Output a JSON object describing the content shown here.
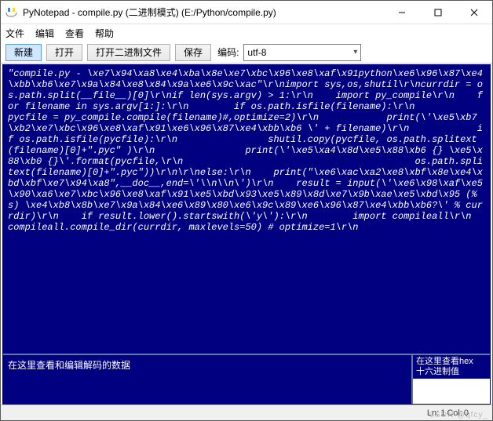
{
  "window": {
    "title": "PyNotepad - compile.py (二进制模式) (E:/Python/compile.py)"
  },
  "menu": {
    "file": "文件",
    "edit": "编辑",
    "view": "查看",
    "help": "帮助"
  },
  "toolbar": {
    "new": "新建",
    "open": "打开",
    "open_binary": "打开二进制文件",
    "save": "保存",
    "encoding_label": "编码:",
    "encoding_value": "utf-8"
  },
  "editor": {
    "content": "\"compile.py - \\xe7\\x94\\xa8\\xe4\\xba\\x8e\\xe7\\xbc\\x96\\xe8\\xaf\\x91python\\xe6\\x96\\x87\\xe4\\xbb\\xb6\\xe7\\x9a\\x84\\xe8\\x84\\x9a\\xe6\\x9c\\xac\"\\r\\nimport sys,os,shutil\\r\\ncurrdir = os.path.split(__file__)[0]\\r\\nif len(sys.argv) > 1:\\r\\n    import py_compile\\r\\n    for filename in sys.argv[1:]:\\r\\n        if os.path.isfile(filename):\\r\\n            pycfile = py_compile.compile(filename)#,optimize=2)\\r\\n            print(\\'\\xe5\\xb7\\xb2\\xe7\\xbc\\x96\\xe8\\xaf\\x91\\xe6\\x96\\x87\\xe4\\xbb\\xb6 \\' + filename)\\r\\n            if os.path.isfile(pycfile):\\r\\n                shutil.copy(pycfile, os.path.splitext(filename)[0]+\".pyc\" )\\r\\n                print(\\'\\xe5\\xa4\\x8d\\xe5\\x88\\xb6 {} \\xe5\\x88\\xb0 {}\\'.format(pycfile,\\r\\n                                         os.path.splitext(filename)[0]+\".pyc\"))\\r\\n\\r\\nelse:\\r\\n    print(\"\\xe6\\xac\\xa2\\xe8\\xbf\\x8e\\xe4\\xbd\\xbf\\xe7\\x94\\xa8\",__doc__,end=\\'\\\\n\\\\n\\')\\r\\n    result = input(\\'\\xe6\\x98\\xaf\\xe5\\x90\\xa6\\xe7\\xbc\\x96\\xe8\\xaf\\x91\\xe5\\xbd\\x93\\xe5\\x89\\x8d\\xe7\\x9b\\xae\\xe5\\xbd\\x95 (%s) \\xe4\\xb8\\x8b\\xe7\\x9a\\x84\\xe6\\x89\\x80\\xe6\\x9c\\x89\\xe6\\x96\\x87\\xe4\\xbb\\xb6?\\' % currdir)\\r\\n    if result.lower().startswith(\\'y\\'):\\r\\n        import compileall\\r\\n        compileall.compile_dir(currdir, maxlevels=50) # optimize=1\\r\\n"
  },
  "panes": {
    "decode_placeholder": "在这里查看和编辑解码的数据",
    "hex_line1": "在这里查看hex",
    "hex_line2": "十六进制值"
  },
  "status": {
    "ln_label": "Ln:",
    "ln_value": "1",
    "col_label": "Col:",
    "col_value": "0"
  },
  "watermark": "CSDN @qfcy_"
}
